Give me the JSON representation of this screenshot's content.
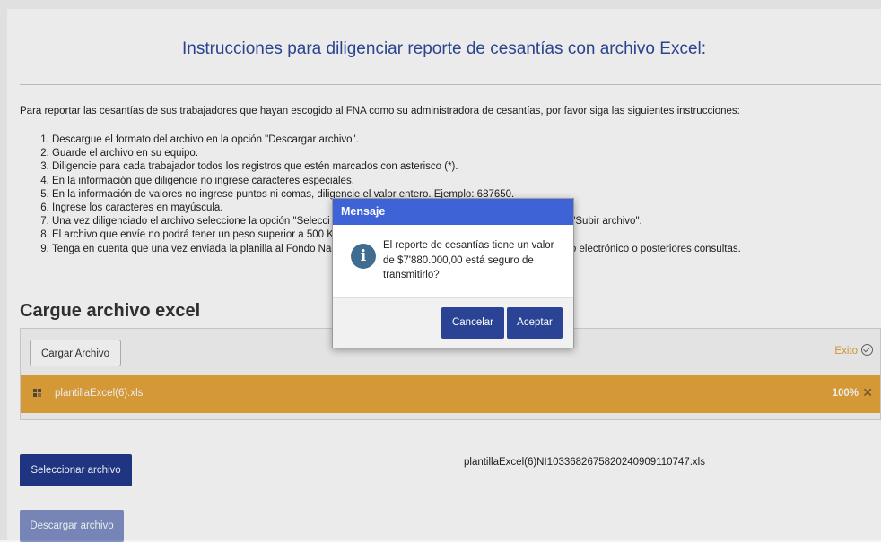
{
  "page": {
    "title": "Instrucciones para diligenciar reporte de cesantías con archivo Excel:",
    "intro": "Para reportar las cesantías de sus trabajadores que hayan escogido al FNA como su administradora de cesantías, por favor siga las siguientes instrucciones:",
    "steps": [
      "Descargue el formato del archivo en la opción \"Descargar archivo\".",
      "Guarde el archivo en su equipo.",
      "Diligencie para cada trabajador todos los registros que estén marcados con asterisco (*).",
      "En la información que diligencie no ingrese caracteres especiales.",
      "En la información de valores no ingrese puntos ni comas, diligencie el valor entero. Ejemplo: 687650.",
      "Ingrese los caracteres en mayúscula.",
      "Una vez diligenciado el archivo seleccione la opción \"Selecci                                                                   opción \"Cargar archivo\" y después solicite la acción \"Subir archivo\".",
      "El archivo que envíe no podrá tener un peso superior a 500 K",
      "Tenga en cuenta que una vez enviada la planilla al Fondo Nac                                                                   de trámite que debe conservar para realizar el pago electrónico o posteriores consultas."
    ]
  },
  "upload": {
    "section_title": "Cargue archivo excel",
    "cargar_label": "Cargar Archivo",
    "status_text": "Exito",
    "file_name": "plantillaExcel(6).xls",
    "progress_text": "100%",
    "progress_value": 1.0,
    "remove_symbol": "✕"
  },
  "actions": {
    "seleccionar_label": "Seleccionar archivo",
    "selected_file": "plantillaExcel(6)NI10336826758202409091107​47.xls",
    "descargar_label": "Descargar archivo"
  },
  "dialog": {
    "title": "Mensaje",
    "icon_glyph": "i",
    "message": "El reporte de cesantías tiene un valor de $7'880.000,00 está seguro de transmitirlo?",
    "cancel_label": "Cancelar",
    "accept_label": "Aceptar"
  },
  "colors": {
    "accent": "#223a8c",
    "dialog_header": "#3d63d7",
    "file_row": "#e8a53b",
    "success": "#e2a237"
  },
  "icons": [
    "file-icon",
    "check-circle-icon",
    "close-icon",
    "info-icon"
  ]
}
